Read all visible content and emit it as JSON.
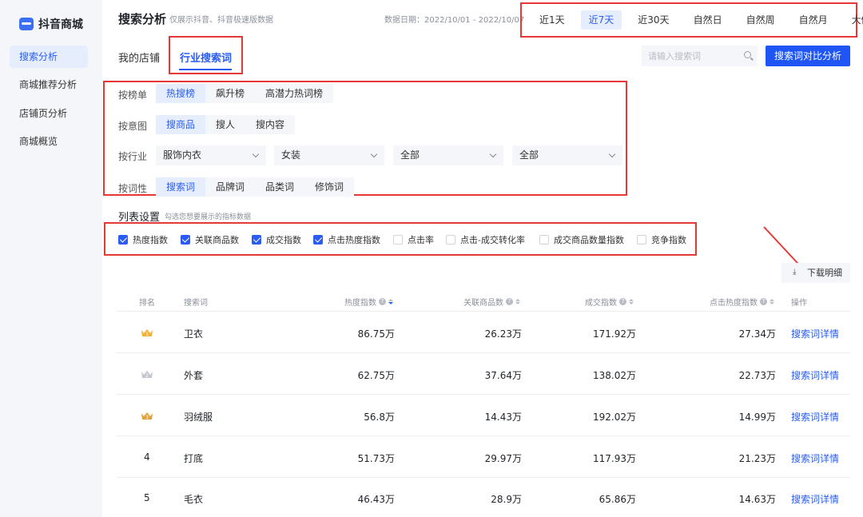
{
  "sidebar": {
    "logo": "抖音商城",
    "items": [
      {
        "label": "搜索分析",
        "active": true
      },
      {
        "label": "商城推荐分析",
        "active": false
      },
      {
        "label": "店铺页分析",
        "active": false
      },
      {
        "label": "商城概览",
        "active": false
      }
    ]
  },
  "header": {
    "title": "搜索分析",
    "subtitle": "仅展示抖音、抖音极速版数据",
    "date_range": "数据日期：2022/10/01 - 2022/10/07",
    "time_tabs": [
      "近1天",
      "近7天",
      "近30天",
      "自然日",
      "自然周",
      "自然月",
      "大促"
    ],
    "active_time_tab": "近7天"
  },
  "shop_tabs": {
    "mine": "我的店铺",
    "industry": "行业搜索词"
  },
  "search": {
    "placeholder": "请输入搜索词",
    "compare_button": "搜索词对比分析"
  },
  "filters": {
    "board": {
      "label": "按榜单",
      "options": [
        "热搜榜",
        "飙升榜",
        "高潜力热词榜"
      ],
      "active": "热搜榜"
    },
    "intent": {
      "label": "按意图",
      "options": [
        "搜商品",
        "搜人",
        "搜内容"
      ],
      "active": "搜商品"
    },
    "industry": {
      "label": "按行业",
      "selects": [
        "服饰内衣",
        "女装",
        "全部",
        "全部"
      ]
    },
    "word_type": {
      "label": "按词性",
      "options": [
        "搜索词",
        "品牌词",
        "品类词",
        "修饰词"
      ],
      "active": "搜索词"
    }
  },
  "list_settings": {
    "title": "列表设置",
    "hint": "勾选您想要展示的指标数据",
    "metrics": [
      {
        "label": "热度指数",
        "checked": true
      },
      {
        "label": "关联商品数",
        "checked": true
      },
      {
        "label": "成交指数",
        "checked": true
      },
      {
        "label": "点击热度指数",
        "checked": true
      },
      {
        "label": "点击率",
        "checked": false
      },
      {
        "label": "点击-成交转化率",
        "checked": false
      },
      {
        "label": "成交商品数量指数",
        "checked": false
      },
      {
        "label": "竞争指数",
        "checked": false
      }
    ]
  },
  "download": {
    "label": "下载明细",
    "icon": "download-icon"
  },
  "table": {
    "headers": {
      "rank": "排名",
      "keyword": "搜索词",
      "heat": "热度指数",
      "related": "关联商品数",
      "deal": "成交指数",
      "click_heat": "点击热度指数",
      "action": "操作"
    },
    "rows": [
      {
        "rank": "1",
        "keyword": "卫衣",
        "heat": "86.75万",
        "related": "26.23万",
        "deal": "171.92万",
        "click_heat": "27.34万",
        "action": "搜索词详情",
        "medal": "gold"
      },
      {
        "rank": "2",
        "keyword": "外套",
        "heat": "62.75万",
        "related": "37.64万",
        "deal": "138.02万",
        "click_heat": "22.73万",
        "action": "搜索词详情",
        "medal": "silver"
      },
      {
        "rank": "3",
        "keyword": "羽绒服",
        "heat": "56.8万",
        "related": "14.43万",
        "deal": "192.02万",
        "click_heat": "14.99万",
        "action": "搜索词详情",
        "medal": "bronze"
      },
      {
        "rank": "4",
        "keyword": "打底",
        "heat": "51.73万",
        "related": "29.97万",
        "deal": "117.93万",
        "click_heat": "21.23万",
        "action": "搜索词详情",
        "medal": ""
      },
      {
        "rank": "5",
        "keyword": "毛衣",
        "heat": "46.43万",
        "related": "28.9万",
        "deal": "65.86万",
        "click_heat": "14.63万",
        "action": "搜索词详情",
        "medal": ""
      }
    ]
  },
  "colors": {
    "accent": "#2a5cf5",
    "highlight": "#e53935",
    "gold": "#f2b233",
    "silver": "#c3c7cf",
    "bronze": "#e0a23a"
  }
}
